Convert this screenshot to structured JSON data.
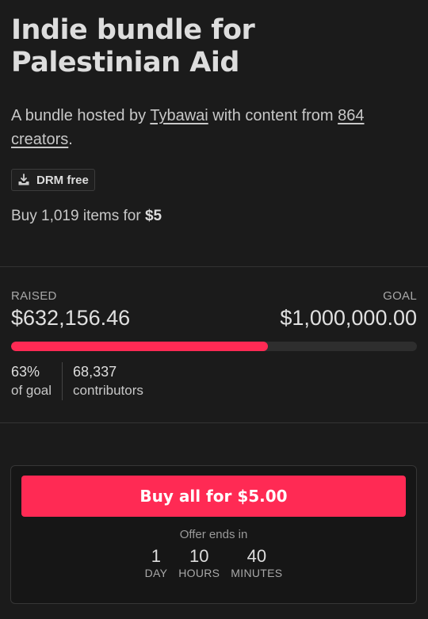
{
  "bundle": {
    "title_line1": "Indie bundle for",
    "title_line2": "Palestinian Aid",
    "byline_prefix": "A bundle hosted by",
    "host": "Tybawai",
    "byline_middle": "with content from",
    "creators_count": "864",
    "creators_word": "creators",
    "byline_suffix": "."
  },
  "badge": {
    "icon": "download-tray-icon",
    "label": "DRM free"
  },
  "offer_line": {
    "prefix": "Buy 1,019 items for",
    "price": "$5"
  },
  "fundraising": {
    "raised_label": "RAISED",
    "raised_amount": "$632,156.46",
    "goal_label": "GOAL",
    "goal_amount": "$1,000,000.00",
    "progress_fraction": 0.632,
    "progress_color": "#ff2a54",
    "percent_value": "63%",
    "percent_caption": "of goal",
    "contributors_value": "68,337",
    "contributors_caption": "contributors"
  },
  "purchase": {
    "button_label": "Buy all for $5.00",
    "button_color": "#ff2a54",
    "offer_ends_label": "Offer ends in",
    "countdown": [
      {
        "value": "1",
        "unit": "DAY"
      },
      {
        "value": "10",
        "unit": "HOURS"
      },
      {
        "value": "40",
        "unit": "MINUTES"
      }
    ]
  }
}
